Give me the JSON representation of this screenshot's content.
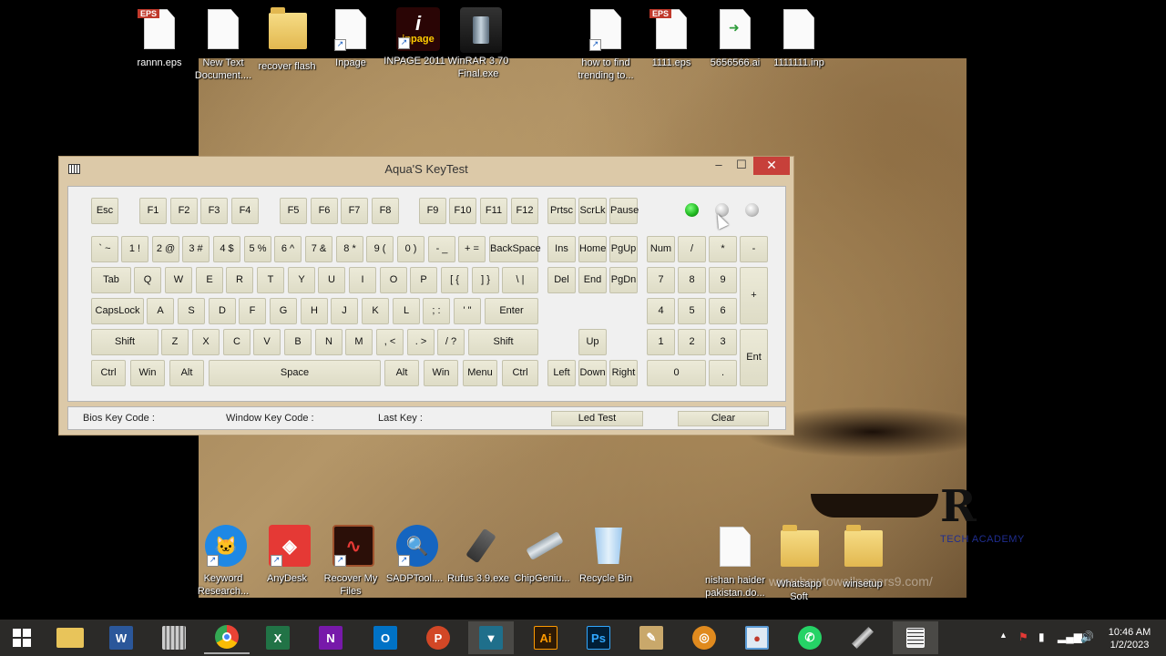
{
  "desktop": {
    "top_icons": [
      {
        "label": "rannn.eps",
        "type": "eps"
      },
      {
        "label": "New Text\nDocument....",
        "type": "doc"
      },
      {
        "label": "recover flash",
        "type": "folder"
      },
      {
        "label": "Inpage",
        "type": "doc-shortcut"
      },
      {
        "label": "INPAGE 2011",
        "type": "inpage"
      },
      {
        "label": "WinRAR 3.70\nFinal.exe",
        "type": "winrar"
      },
      {
        "label": "how to find\ntrending to...",
        "type": "doc-shortcut"
      },
      {
        "label": "1111.eps",
        "type": "eps"
      },
      {
        "label": "5656566.ai",
        "type": "ai"
      },
      {
        "label": "1111111.inp",
        "type": "doc"
      }
    ],
    "bottom_icons": [
      {
        "label": "Keyword\nResearch...",
        "color": "#1e88e5"
      },
      {
        "label": "AnyDesk",
        "color": "#e53935"
      },
      {
        "label": "Recover My\nFiles",
        "color": "#8e2a1b"
      },
      {
        "label": "SADPTool....",
        "color": "#1565c0"
      },
      {
        "label": "Rufus 3.9.exe",
        "color": "#555555"
      },
      {
        "label": "ChipGeniu...",
        "color": "#78909c"
      },
      {
        "label": "Recycle Bin",
        "color": "#90caf9"
      },
      {
        "label": "nishan haider\npakistan.do...",
        "color": "#ffffff"
      },
      {
        "label": "Whatsapp\nSoft",
        "color": "#e2b850"
      },
      {
        "label": "winsetup",
        "color": "#e2b850"
      }
    ],
    "eps_badge": "EPS",
    "inpage_badge": "inpage",
    "brand_letter": "R",
    "brand_sub": "TECH ACADEMY",
    "watermark": "www.howtowallpapers9.com/"
  },
  "window": {
    "title": "Aqua'S KeyTest",
    "minimize": "–",
    "maximize": "☐",
    "close": "✕",
    "leds": [
      "#22bb22",
      "#c8c8c8",
      "#c8c8c8"
    ],
    "status": {
      "bios_label": "Bios Key Code :",
      "window_label": "Window Key Code :",
      "last_key_label": "Last Key :",
      "led_test": "Led Test",
      "clear": "Clear"
    },
    "keys": {
      "esc": "Esc",
      "f1": "F1",
      "f2": "F2",
      "f3": "F3",
      "f4": "F4",
      "f5": "F5",
      "f6": "F6",
      "f7": "F7",
      "f8": "F8",
      "f9": "F9",
      "f10": "F10",
      "f11": "F11",
      "f12": "F12",
      "prtsc": "Prtsc",
      "scrlk": "ScrLk",
      "pause": "Pause",
      "grave": "` ~",
      "k1": "1 !",
      "k2": "2 @",
      "k3": "3 #",
      "k4": "4 $",
      "k5": "5 %",
      "k6": "6 ^",
      "k7": "7 &",
      "k8": "8 *",
      "k9": "9 (",
      "k0": "0 )",
      "minus": "- _",
      "equal": "+ =",
      "backspace": "BackSpace",
      "ins": "Ins",
      "home": "Home",
      "pgup": "PgUp",
      "num": "Num",
      "np_div": "/",
      "np_mul": "*",
      "np_minus": "-",
      "tab": "Tab",
      "q": "Q",
      "w": "W",
      "e": "E",
      "r": "R",
      "t": "T",
      "y": "Y",
      "u": "U",
      "i": "I",
      "o": "O",
      "p": "P",
      "lbracket": "[ {",
      "rbracket": "] }",
      "backslash": "\\ |",
      "del": "Del",
      "end": "End",
      "pgdn": "PgDn",
      "np7": "7",
      "np8": "8",
      "np9": "9",
      "np_plus": "+",
      "capslock": "CapsLock",
      "a": "A",
      "s": "S",
      "d": "D",
      "f": "F",
      "g": "G",
      "h": "H",
      "j": "J",
      "k": "K",
      "l": "L",
      "semicolon": "; :",
      "quote": "' \"",
      "enter": "Enter",
      "np4": "4",
      "np5": "5",
      "np6": "6",
      "lshift": "Shift",
      "z": "Z",
      "x": "X",
      "c": "C",
      "v": "V",
      "b": "B",
      "n": "N",
      "m": "M",
      "comma": ", <",
      "period": ". >",
      "slash": "/ ?",
      "rshift": "Shift",
      "up": "Up",
      "np1": "1",
      "np2": "2",
      "np3": "3",
      "np_ent": "Ent",
      "lctrl": "Ctrl",
      "lwin": "Win",
      "lalt": "Alt",
      "space": "Space",
      "ralt": "Alt",
      "rwin": "Win",
      "menu": "Menu",
      "rctrl": "Ctrl",
      "left": "Left",
      "down": "Down",
      "right": "Right",
      "np0": "0",
      "np_dot": "."
    }
  },
  "taskbar": {
    "apps": [
      {
        "name": "file-explorer",
        "label": "",
        "color": "#e8c45a"
      },
      {
        "name": "word",
        "label": "W",
        "color": "#2b579a"
      },
      {
        "name": "keyboard-app",
        "label": "",
        "color": "#777777"
      },
      {
        "name": "chrome",
        "label": "",
        "color": "#4caf50"
      },
      {
        "name": "excel",
        "label": "X",
        "color": "#217346"
      },
      {
        "name": "onenote",
        "label": "N",
        "color": "#7719aa"
      },
      {
        "name": "outlook",
        "label": "O",
        "color": "#0072c6"
      },
      {
        "name": "powerpoint",
        "label": "P",
        "color": "#d24726"
      },
      {
        "name": "screen-tool",
        "label": "",
        "color": "#1f6f8b"
      },
      {
        "name": "illustrator",
        "label": "Ai",
        "color": "#2e1a05"
      },
      {
        "name": "photoshop",
        "label": "Ps",
        "color": "#001e36"
      },
      {
        "name": "installer",
        "label": "",
        "color": "#c9a86b"
      },
      {
        "name": "burner",
        "label": "",
        "color": "#e08a1e"
      },
      {
        "name": "remote-tool",
        "label": "",
        "color": "#5b9bd5"
      },
      {
        "name": "whatsapp",
        "label": "",
        "color": "#25d366"
      },
      {
        "name": "usb-tool",
        "label": "",
        "color": "#888888"
      },
      {
        "name": "keytest",
        "label": "",
        "color": "#aaaaaa"
      }
    ],
    "time": "10:46 AM",
    "date": "1/2/2023"
  }
}
